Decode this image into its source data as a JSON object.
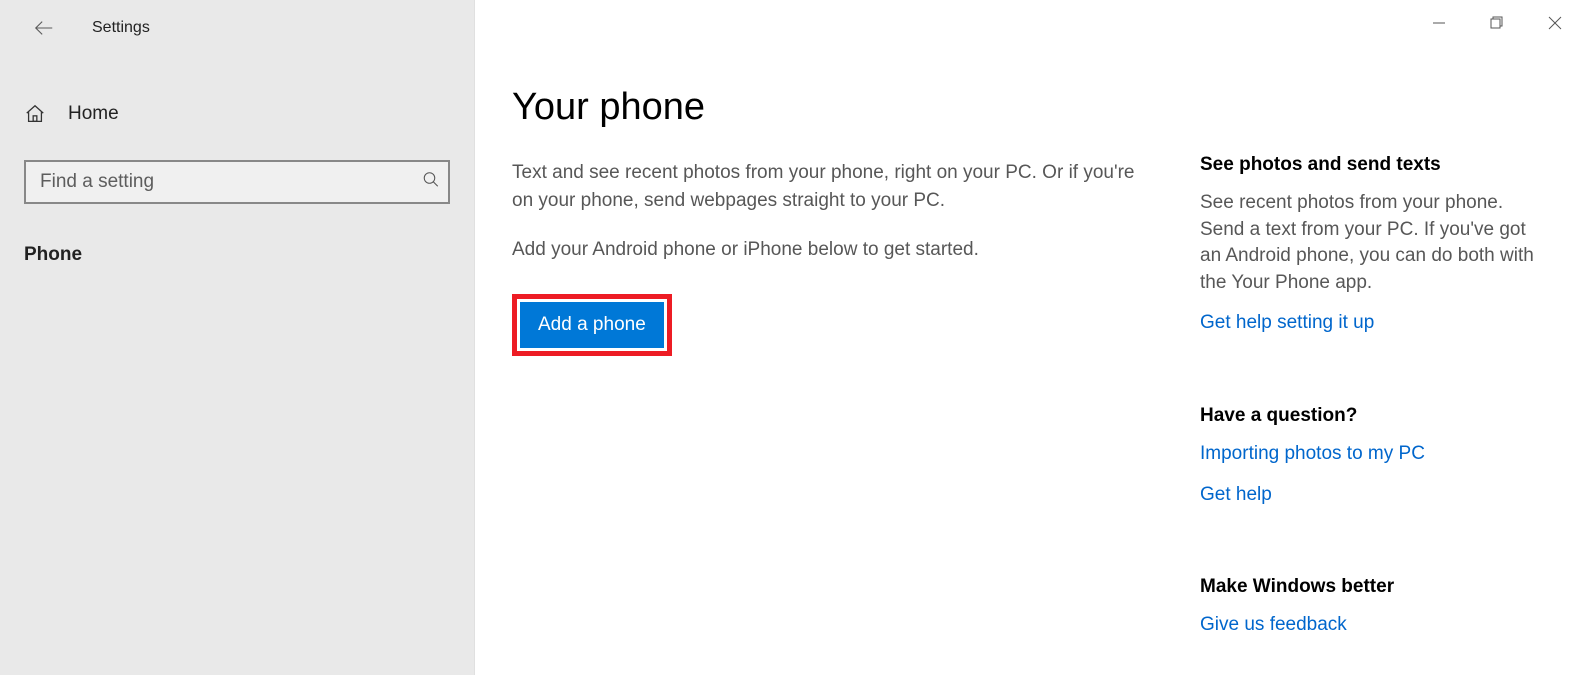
{
  "header": {
    "back_icon": "back-arrow",
    "title": "Settings"
  },
  "sidebar": {
    "home_label": "Home",
    "search_placeholder": "Find a setting",
    "nav_item": "Phone"
  },
  "main": {
    "title": "Your phone",
    "desc1": "Text and see recent photos from your phone, right on your PC. Or if you're on your phone, send webpages straight to your PC.",
    "desc2": "Add your Android phone or iPhone below to get started.",
    "button_label": "Add a phone"
  },
  "side": {
    "section1": {
      "heading": "See photos and send texts",
      "body": "See recent photos from your phone. Send a text from your PC. If you've got an Android phone, you can do both with the Your Phone app.",
      "link": "Get help setting it up"
    },
    "section2": {
      "heading": "Have a question?",
      "link1": "Importing photos to my PC",
      "link2": "Get help"
    },
    "section3": {
      "heading": "Make Windows better",
      "link": "Give us feedback"
    }
  }
}
